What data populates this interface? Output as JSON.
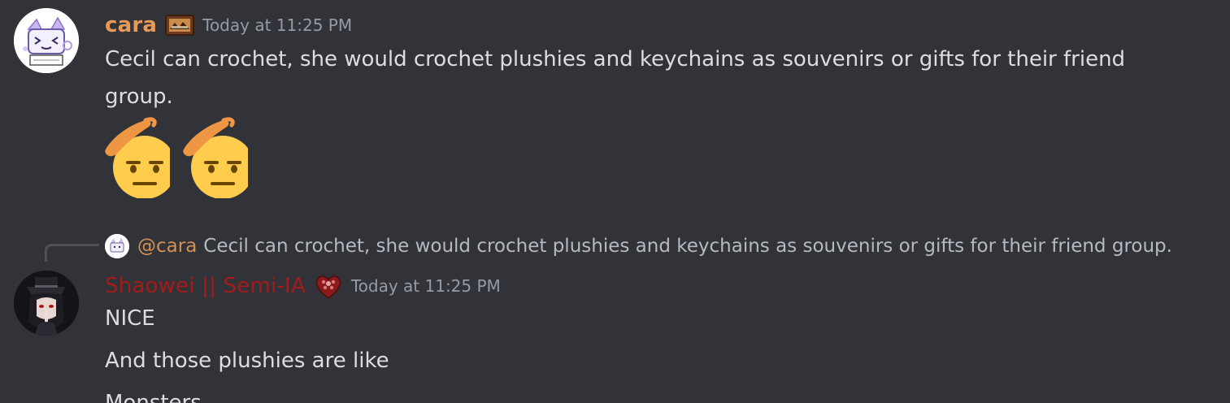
{
  "messages": [
    {
      "author": "cara",
      "author_color": "#e69a57",
      "avatar_icon": "sketch-cat-avatar",
      "badge_icon": "framed-art-badge",
      "timestamp": "Today at 11:25 PM",
      "text": "Cecil can crochet, she would crochet plushies and keychains as souvenirs or gifts for their friend group.",
      "emojis": [
        "saluting-face-emoji",
        "saluting-face-emoji"
      ]
    },
    {
      "reply": {
        "mention": "@cara",
        "text": "Cecil can crochet, she would crochet plushies and keychains as souvenirs or gifts for their friend group."
      },
      "author": "Shaowei || Semi-IA",
      "author_color": "#a31b1b",
      "avatar_icon": "dark-hat-figure-avatar",
      "badge_icon": "red-flower-heart-badge",
      "timestamp": "Today at 11:25 PM",
      "lines": [
        "NICE",
        "And those plushies are like",
        "Monsters"
      ]
    }
  ]
}
